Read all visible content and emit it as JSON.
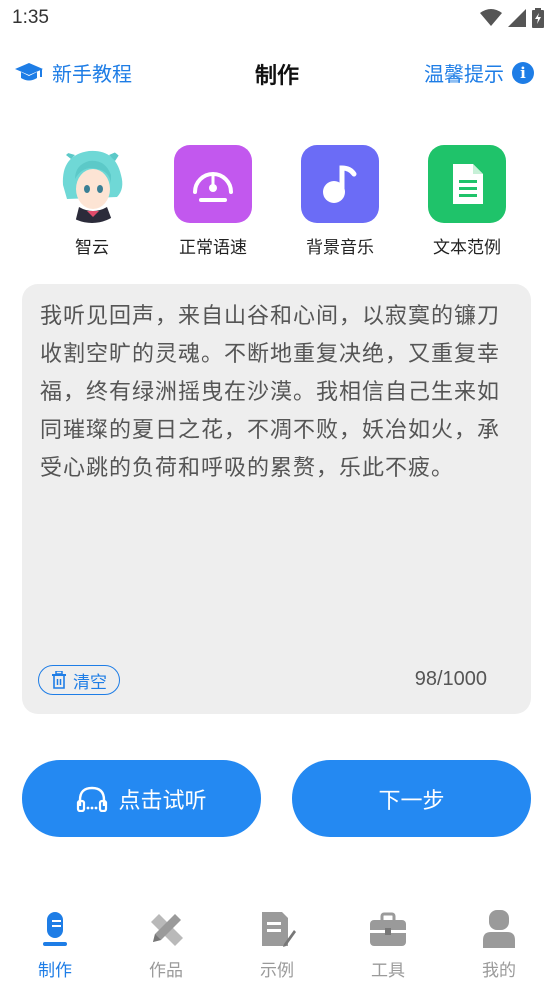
{
  "status_bar": {
    "time": "1:35"
  },
  "header": {
    "tutorial_label": "新手教程",
    "title": "制作",
    "tips_label": "温馨提示",
    "info_glyph": "i"
  },
  "tools": [
    {
      "label": "智云",
      "icon": "avatar-image"
    },
    {
      "label": "正常语速",
      "icon": "speedometer-icon",
      "color": "#c258ee"
    },
    {
      "label": "背景音乐",
      "icon": "music-note-icon",
      "color": "#6b6cf6"
    },
    {
      "label": "文本范例",
      "icon": "document-icon",
      "color": "#1fc36a"
    }
  ],
  "editor": {
    "text": "我听见回声，来自山谷和心间，以寂寞的镰刀收割空旷的灵魂。不断地重复决绝，又重复幸福，终有绿洲摇曳在沙漠。我相信自己生来如同璀璨的夏日之花，不凋不败，妖冶如火，承受心跳的负荷和呼吸的累赘，乐此不疲。",
    "clear_label": "清空",
    "counter": "98/1000"
  },
  "actions": {
    "listen_label": "点击试听",
    "next_label": "下一步"
  },
  "bottom_nav": [
    {
      "label": "制作",
      "icon": "microphone-icon",
      "active": true
    },
    {
      "label": "作品",
      "icon": "pencil-ruler-icon",
      "active": false
    },
    {
      "label": "示例",
      "icon": "edit-document-icon",
      "active": false
    },
    {
      "label": "工具",
      "icon": "toolbox-icon",
      "active": false
    },
    {
      "label": "我的",
      "icon": "user-icon",
      "active": false
    }
  ],
  "colors": {
    "accent": "#1e7de6",
    "button": "#2489f2",
    "card_bg": "#eeeeee",
    "inactive": "#9a9a9a"
  }
}
